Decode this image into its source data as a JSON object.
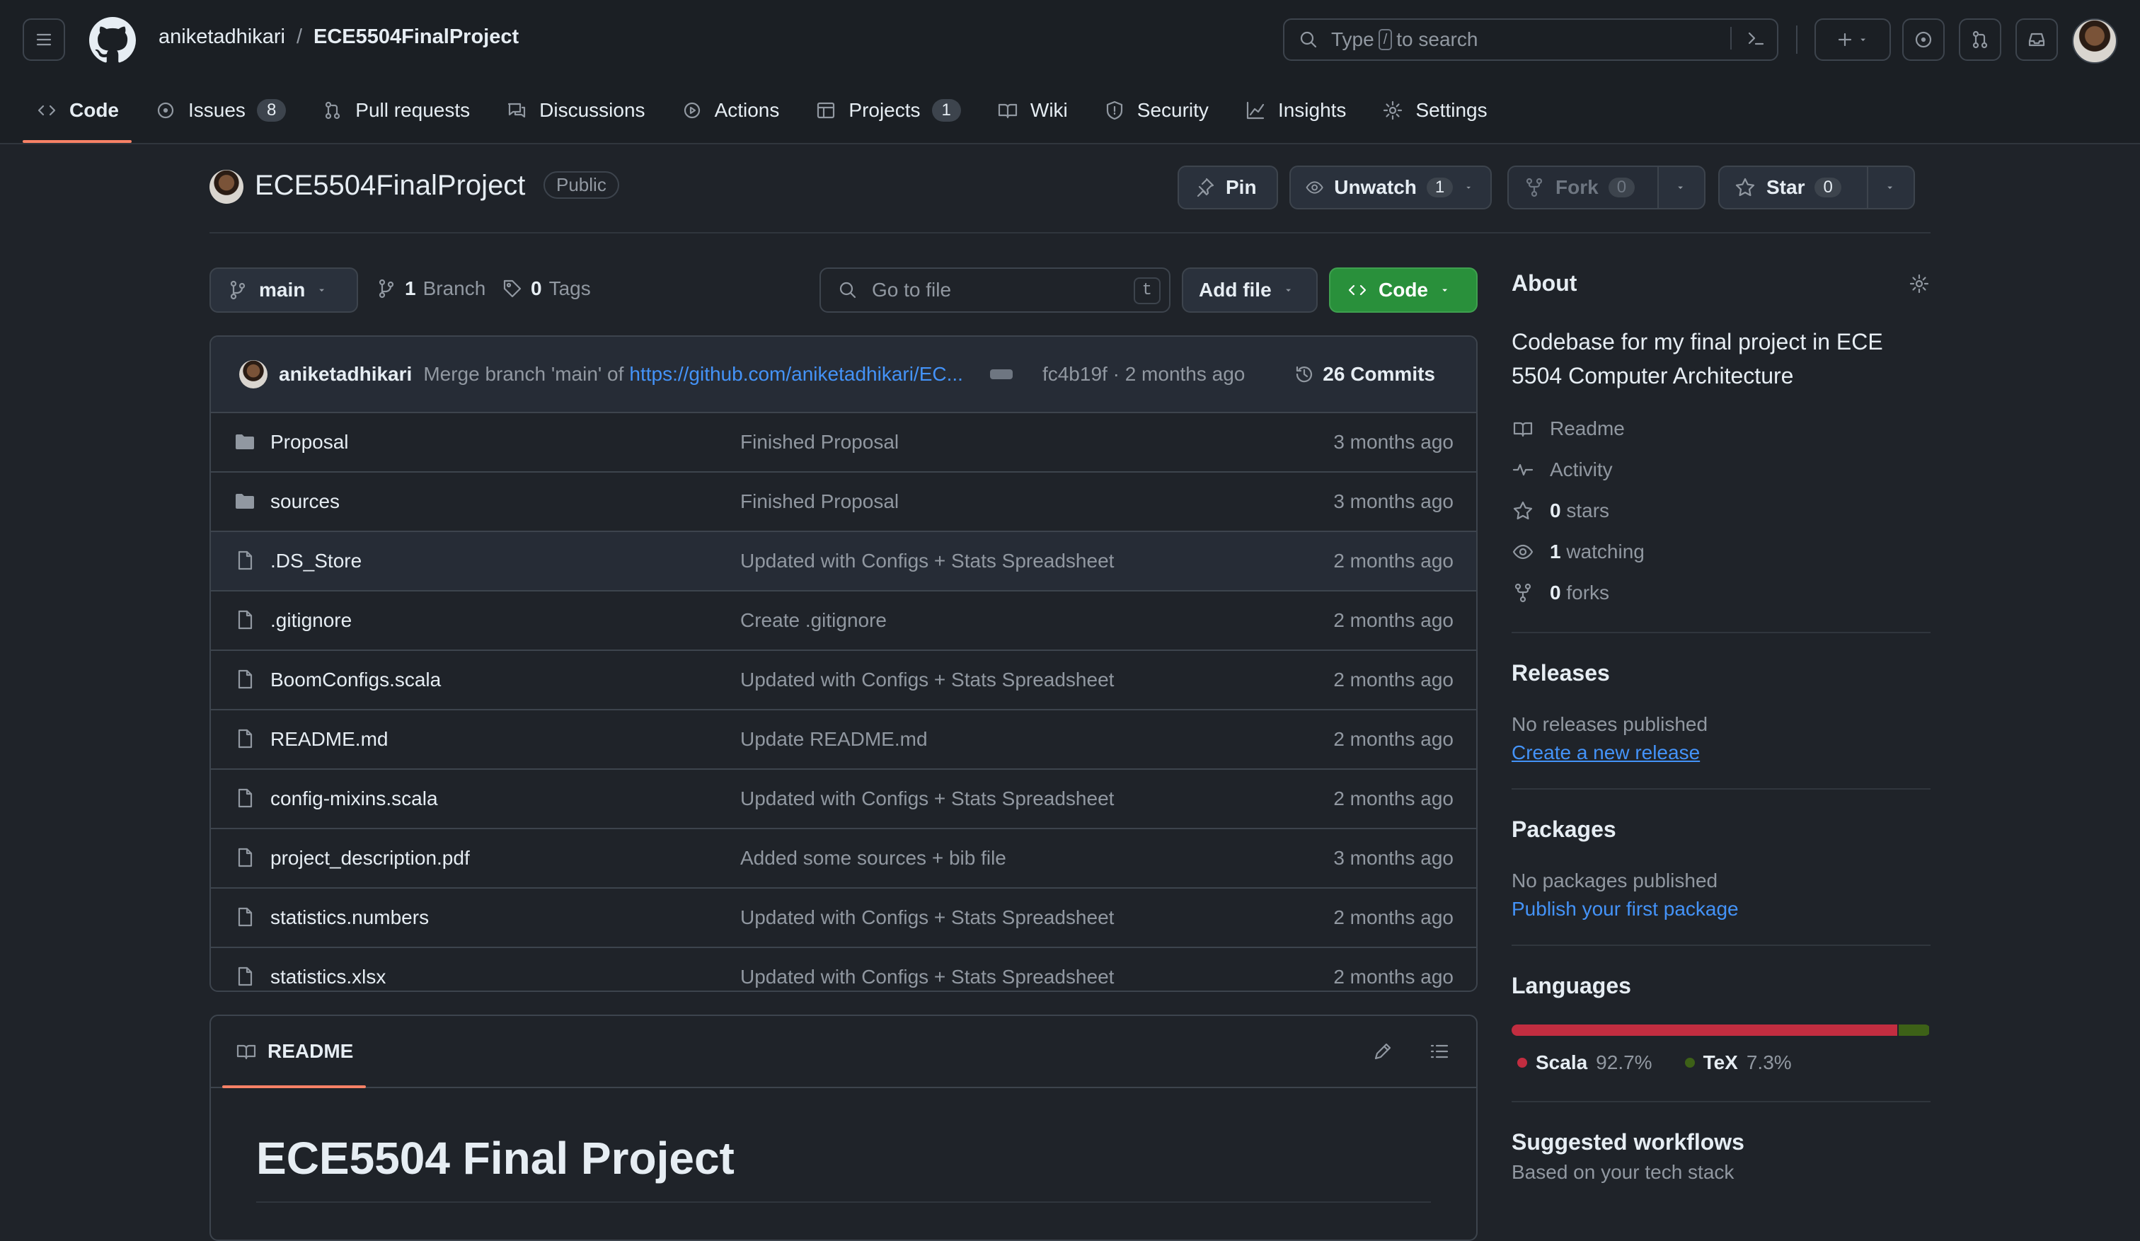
{
  "header": {
    "owner": "aniketadhikari",
    "separator": "/",
    "repo": "ECE5504FinalProject",
    "search_placeholder": "Type",
    "search_slash": "/",
    "search_suffix": "to search"
  },
  "tabs": [
    {
      "label": "Code",
      "icon": "code-icon"
    },
    {
      "label": "Issues",
      "icon": "issue-icon",
      "count": "8"
    },
    {
      "label": "Pull requests",
      "icon": "pull-request-icon"
    },
    {
      "label": "Discussions",
      "icon": "discussion-icon"
    },
    {
      "label": "Actions",
      "icon": "play-icon"
    },
    {
      "label": "Projects",
      "icon": "table-icon",
      "count": "1"
    },
    {
      "label": "Wiki",
      "icon": "book-icon"
    },
    {
      "label": "Security",
      "icon": "shield-icon"
    },
    {
      "label": "Insights",
      "icon": "graph-icon"
    },
    {
      "label": "Settings",
      "icon": "gear-icon"
    }
  ],
  "repo_head": {
    "name": "ECE5504FinalProject",
    "visibility": "Public",
    "pin_label": "Pin",
    "watch_label": "Unwatch",
    "watch_count": "1",
    "fork_label": "Fork",
    "fork_count": "0",
    "star_label": "Star",
    "star_count": "0"
  },
  "toolbar": {
    "branch": "main",
    "branch_count": "1",
    "branch_label": "Branch",
    "tag_count": "0",
    "tag_label": "Tags",
    "goto_placeholder": "Go to file",
    "goto_key": "t",
    "add_file": "Add file",
    "code": "Code"
  },
  "commit": {
    "author": "aniketadhikari",
    "message": "Merge branch 'main' of",
    "link": "https://github.com/aniketadhikari/EC...",
    "hash": "fc4b19f",
    "age": "· 2 months ago",
    "commits_label": "26 Commits"
  },
  "files": [
    {
      "name": "Proposal",
      "type": "folder",
      "message": "Finished Proposal",
      "age": "3 months ago"
    },
    {
      "name": "sources",
      "type": "folder",
      "message": "Finished Proposal",
      "age": "3 months ago"
    },
    {
      "name": ".DS_Store",
      "type": "file",
      "message": "Updated with Configs + Stats Spreadsheet",
      "age": "2 months ago"
    },
    {
      "name": ".gitignore",
      "type": "file",
      "message": "Create .gitignore",
      "age": "2 months ago"
    },
    {
      "name": "BoomConfigs.scala",
      "type": "file",
      "message": "Updated with Configs + Stats Spreadsheet",
      "age": "2 months ago"
    },
    {
      "name": "README.md",
      "type": "file",
      "message": "Update README.md",
      "age": "2 months ago"
    },
    {
      "name": "config-mixins.scala",
      "type": "file",
      "message": "Updated with Configs + Stats Spreadsheet",
      "age": "2 months ago"
    },
    {
      "name": "project_description.pdf",
      "type": "file",
      "message": "Added some sources + bib file",
      "age": "3 months ago"
    },
    {
      "name": "statistics.numbers",
      "type": "file",
      "message": "Updated with Configs + Stats Spreadsheet",
      "age": "2 months ago"
    },
    {
      "name": "statistics.xlsx",
      "type": "file",
      "message": "Updated with Configs + Stats Spreadsheet",
      "age": "2 months ago"
    }
  ],
  "readme": {
    "tab_label": "README",
    "title": "ECE5504 Final Project"
  },
  "about": {
    "heading": "About",
    "description": "Codebase for my final project in ECE 5504 Computer Architecture",
    "readme": "Readme",
    "activity": "Activity",
    "stars_count": "0",
    "stars_label": "stars",
    "watching_count": "1",
    "watching_label": "watching",
    "forks_count": "0",
    "forks_label": "forks"
  },
  "releases": {
    "heading": "Releases",
    "empty": "No releases published",
    "link": "Create a new release"
  },
  "packages": {
    "heading": "Packages",
    "empty": "No packages published",
    "link": "Publish your first package"
  },
  "languages": {
    "heading": "Languages",
    "items": [
      {
        "name": "Scala",
        "percent_label": "92.7%",
        "percent": 92.7,
        "color": "#c22d40"
      },
      {
        "name": "TeX",
        "percent_label": "7.3%",
        "percent": 7.3,
        "color": "#3d6117"
      }
    ]
  },
  "workflows": {
    "heading": "Suggested workflows",
    "sub": "Based on your tech stack"
  },
  "colors": {
    "accent_underline": "#f78166",
    "link": "#4493f8",
    "green_button": "#29903b"
  }
}
